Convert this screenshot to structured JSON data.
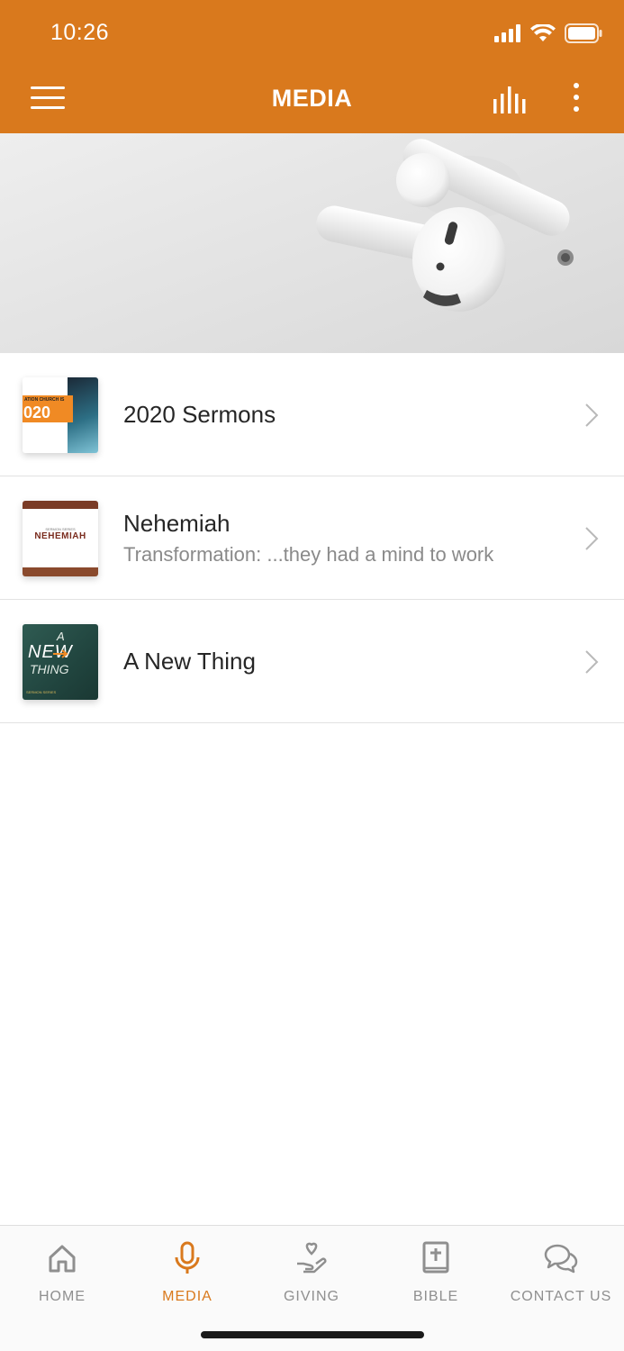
{
  "status_bar": {
    "time": "10:26"
  },
  "header": {
    "title": "MEDIA"
  },
  "list": [
    {
      "title": "2020 Sermons",
      "subtitle": "",
      "thumb": {
        "text_top": "ATION CHURCH IS",
        "text_big": "020"
      }
    },
    {
      "title": "Nehemiah",
      "subtitle": "Transformation: ...they had a mind to work",
      "thumb": {
        "series": "SERMON SERIES",
        "name": "NEHEMIAH"
      }
    },
    {
      "title": "A New Thing",
      "subtitle": "",
      "thumb": {
        "a": "A",
        "new": "NEW",
        "thing": "THING",
        "footer": "SERMON SERIES"
      }
    }
  ],
  "tabs": [
    {
      "label": "HOME",
      "icon": "home-icon"
    },
    {
      "label": "MEDIA",
      "icon": "microphone-icon"
    },
    {
      "label": "GIVING",
      "icon": "giving-hand-icon"
    },
    {
      "label": "BIBLE",
      "icon": "bible-icon"
    },
    {
      "label": "CONTACT US",
      "icon": "chat-bubbles-icon"
    }
  ],
  "colors": {
    "accent": "#d9791d",
    "tab_inactive": "#8f8f8f",
    "divider": "#e2e2e2"
  }
}
